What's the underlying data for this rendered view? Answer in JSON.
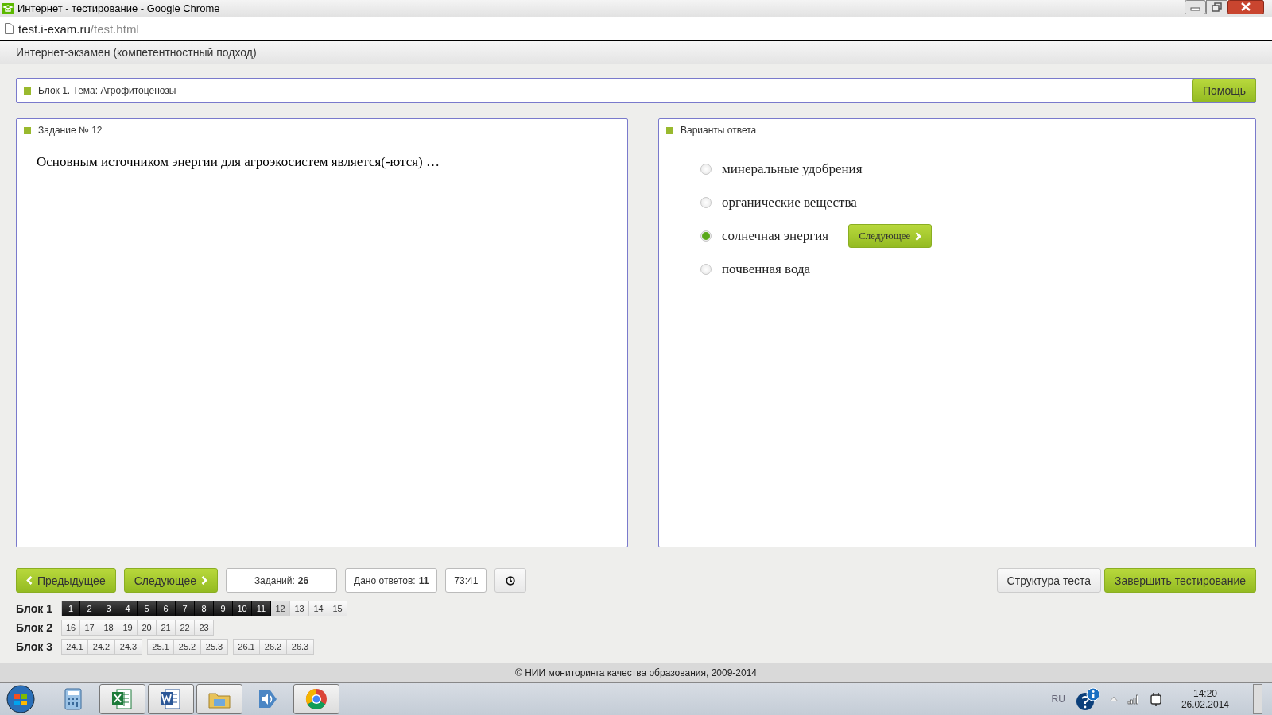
{
  "window": {
    "title": "Интернет - тестирование - Google Chrome"
  },
  "address_bar": {
    "host": "test.i-exam.ru",
    "path": "/test.html"
  },
  "app_header": "Интернет-экзамен (компетентностный подход)",
  "block_bar": {
    "title": "Блок 1. Тема: Агрофитоценозы",
    "help_button": "Помощь"
  },
  "question_panel": {
    "title": "Задание № 12",
    "question": "Основным источником энергии для агроэкосистем является(-ются) …"
  },
  "answers_panel": {
    "title": "Варианты ответа",
    "next_button": "Следующее",
    "options": [
      {
        "label": "минеральные удобрения",
        "selected": false
      },
      {
        "label": "органические вещества",
        "selected": false
      },
      {
        "label": "солнечная энергия",
        "selected": true
      },
      {
        "label": "почвенная вода",
        "selected": false
      }
    ]
  },
  "toolbar": {
    "prev_button": "Предыдущее",
    "next_button": "Следующее",
    "tasks_label": "Заданий:",
    "tasks_count": "26",
    "answers_label": "Дано ответов:",
    "answers_count": "11",
    "timer": "73:41",
    "structure_button": "Структура теста",
    "finish_button": "Завершить тестирование"
  },
  "blocks": [
    {
      "label": "Блок 1",
      "groups": [
        [
          {
            "label": "1",
            "answered": true,
            "selected": false
          },
          {
            "label": "2",
            "answered": true,
            "selected": false
          },
          {
            "label": "3",
            "answered": true,
            "selected": false
          },
          {
            "label": "4",
            "answered": true,
            "selected": false
          },
          {
            "label": "5",
            "answered": true,
            "selected": false
          },
          {
            "label": "6",
            "answered": true,
            "selected": false
          },
          {
            "label": "7",
            "answered": true,
            "selected": false
          },
          {
            "label": "8",
            "answered": true,
            "selected": false
          },
          {
            "label": "9",
            "answered": true,
            "selected": false
          },
          {
            "label": "10",
            "answered": true,
            "selected": false
          },
          {
            "label": "11",
            "answered": true,
            "selected": false
          },
          {
            "label": "12",
            "answered": false,
            "selected": true
          },
          {
            "label": "13",
            "answered": false,
            "selected": false
          },
          {
            "label": "14",
            "answered": false,
            "selected": false
          },
          {
            "label": "15",
            "answered": false,
            "selected": false
          }
        ]
      ]
    },
    {
      "label": "Блок 2",
      "groups": [
        [
          {
            "label": "16",
            "answered": false,
            "selected": false
          },
          {
            "label": "17",
            "answered": false,
            "selected": false
          },
          {
            "label": "18",
            "answered": false,
            "selected": false
          },
          {
            "label": "19",
            "answered": false,
            "selected": false
          },
          {
            "label": "20",
            "answered": false,
            "selected": false
          },
          {
            "label": "21",
            "answered": false,
            "selected": false
          },
          {
            "label": "22",
            "answered": false,
            "selected": false
          },
          {
            "label": "23",
            "answered": false,
            "selected": false
          }
        ]
      ]
    },
    {
      "label": "Блок 3",
      "groups": [
        [
          {
            "label": "24.1",
            "answered": false,
            "selected": false
          },
          {
            "label": "24.2",
            "answered": false,
            "selected": false
          },
          {
            "label": "24.3",
            "answered": false,
            "selected": false
          }
        ],
        [
          {
            "label": "25.1",
            "answered": false,
            "selected": false
          },
          {
            "label": "25.2",
            "answered": false,
            "selected": false
          },
          {
            "label": "25.3",
            "answered": false,
            "selected": false
          }
        ],
        [
          {
            "label": "26.1",
            "answered": false,
            "selected": false
          },
          {
            "label": "26.2",
            "answered": false,
            "selected": false
          },
          {
            "label": "26.3",
            "answered": false,
            "selected": false
          }
        ]
      ]
    }
  ],
  "footer": "© НИИ мониторинга качества образования, 2009-2014",
  "taskbar": {
    "apps": [
      {
        "kind": "calculator",
        "selected": false
      },
      {
        "kind": "spreadsheet",
        "selected": true
      },
      {
        "kind": "document",
        "selected": true
      },
      {
        "kind": "folder",
        "selected": true
      },
      {
        "kind": "speaker",
        "selected": false
      },
      {
        "kind": "browser",
        "selected": true
      }
    ],
    "language": "RU",
    "time": "14:20",
    "date": "26.02.2014"
  }
}
